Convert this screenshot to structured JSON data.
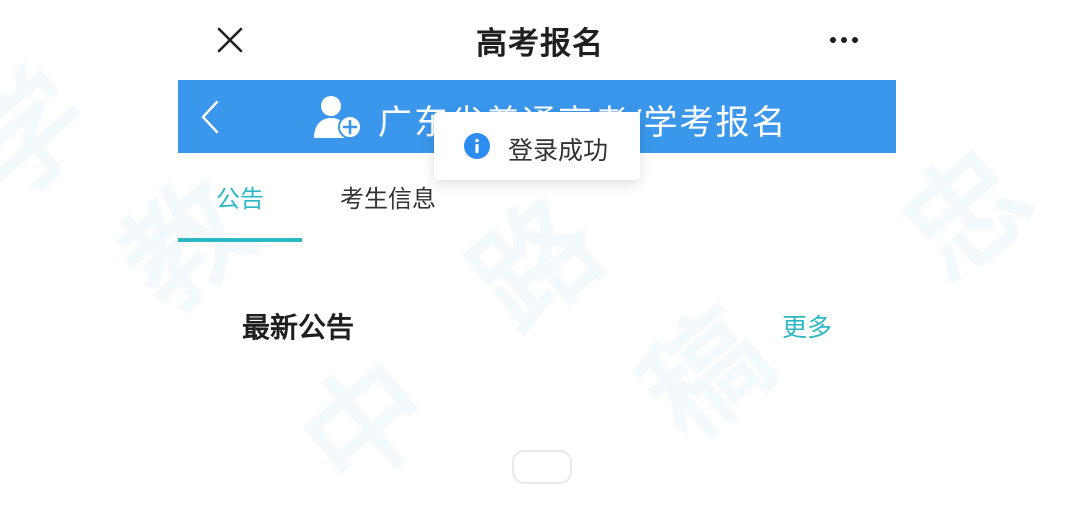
{
  "window": {
    "title": "高考报名",
    "close_icon": "close-icon",
    "more_icon": "more-horizontal-icon"
  },
  "header": {
    "title": "广东省普通高考/学考报名",
    "logo_icon": "user-add-icon",
    "back_icon": "chevron-left-icon",
    "background_color": "#3a97ec"
  },
  "tabs": [
    {
      "label": "公告",
      "active": true
    },
    {
      "label": "考生信息",
      "active": false
    }
  ],
  "section": {
    "title": "最新公告",
    "more_label": "更多"
  },
  "toast": {
    "text": "登录成功",
    "icon": "info-icon",
    "icon_color": "#2d8cf0"
  },
  "colors": {
    "accent": "#2bb8c4",
    "header_blue": "#3a97ec"
  }
}
